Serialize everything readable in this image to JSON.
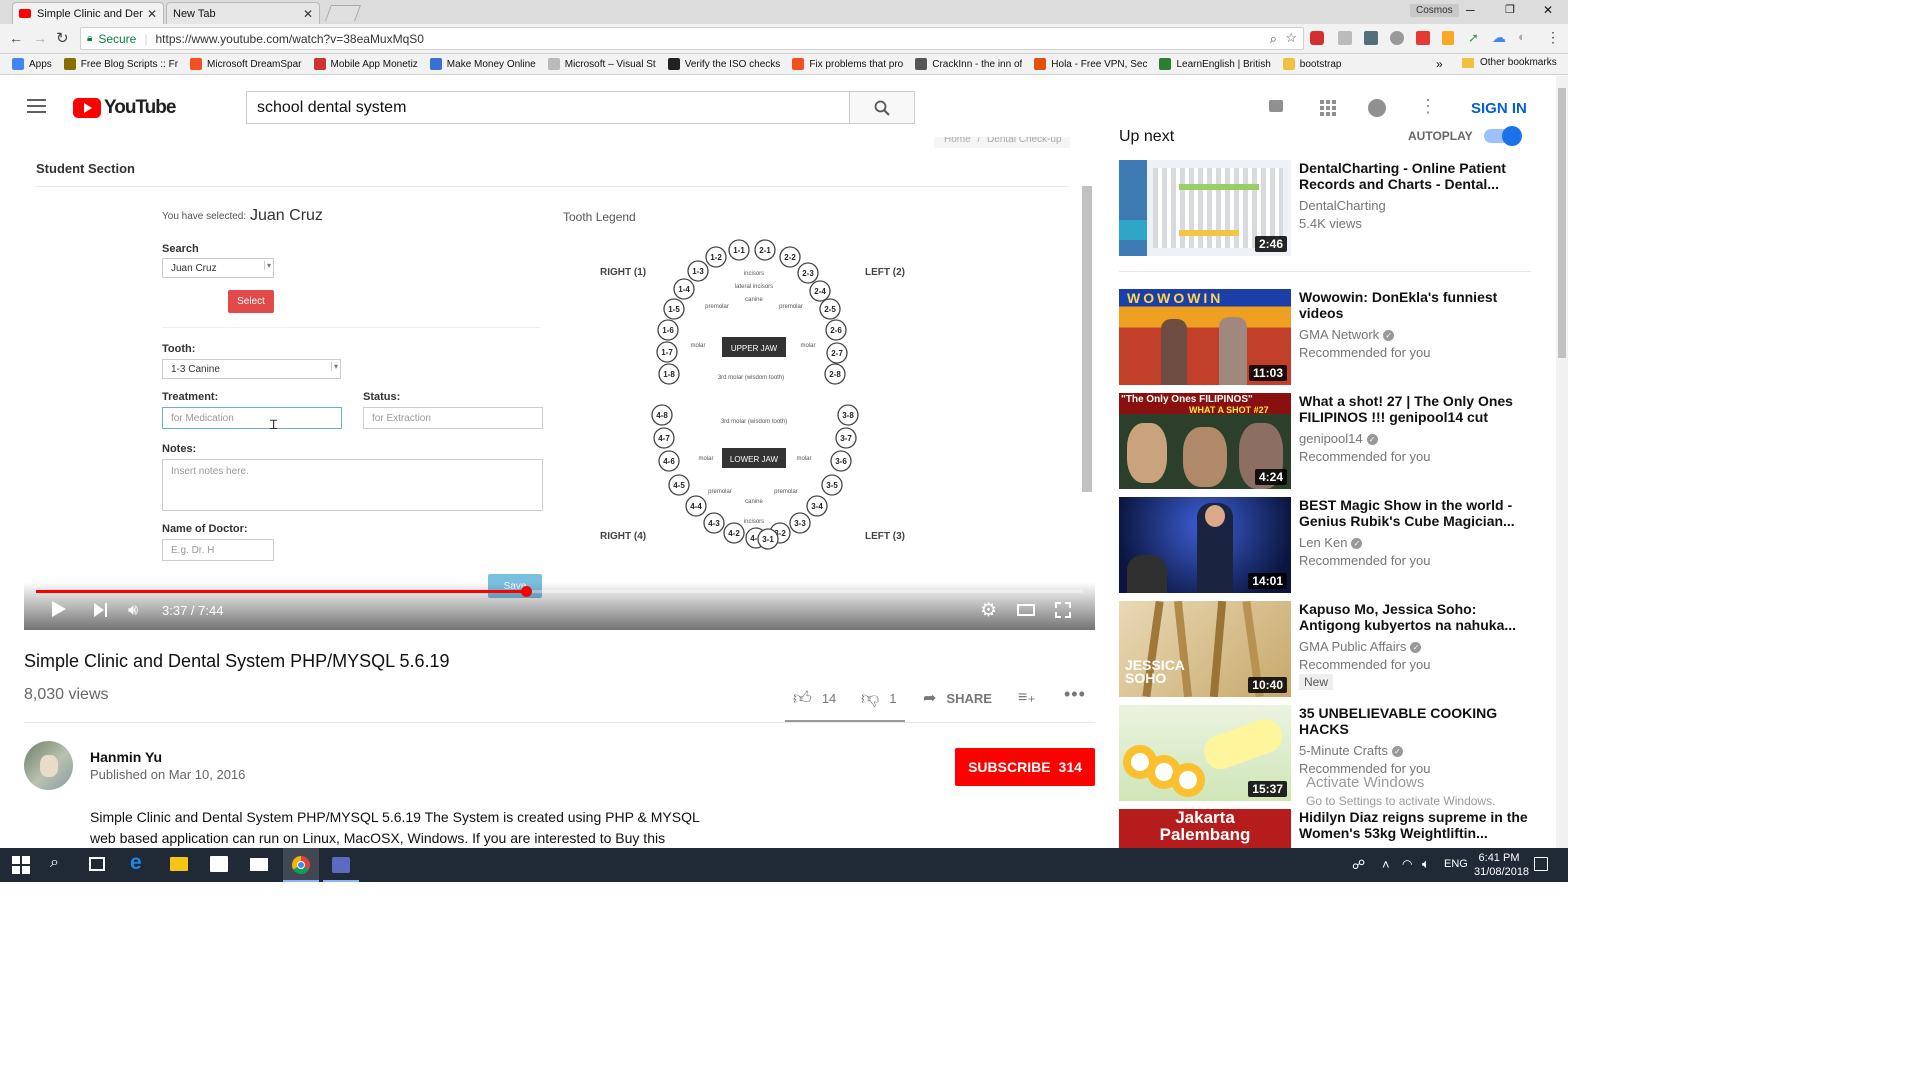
{
  "browser": {
    "tabs": [
      {
        "title": "Simple Clinic and Dental"
      },
      {
        "title": "New Tab"
      }
    ],
    "user": "Cosmos",
    "secure_label": "Secure",
    "url": "https://www.youtube.com/watch?v=38eaMuxMqS0",
    "bookmarks": [
      {
        "label": "Apps",
        "color": "#4285f4"
      },
      {
        "label": "Free Blog Scripts :: Fr",
        "color": "#8a6d00"
      },
      {
        "label": "Microsoft DreamSpar",
        "color": "#f25022"
      },
      {
        "label": "Mobile App Monetiz",
        "color": "#d32f2f"
      },
      {
        "label": "Make Money Online",
        "color": "#3b6fd6"
      },
      {
        "label": "Microsoft – Visual St",
        "color": "#bbbbbb"
      },
      {
        "label": "Verify the ISO checks",
        "color": "#222222"
      },
      {
        "label": "Fix problems that pro",
        "color": "#f25022"
      },
      {
        "label": "CrackInn - the inn of",
        "color": "#555555"
      },
      {
        "label": "Hola - Free VPN, Sec",
        "color": "#e65100"
      },
      {
        "label": "LearnEnglish | British",
        "color": "#2e7d32"
      },
      {
        "label": "bootstrap",
        "color": "#f0c040"
      }
    ],
    "bookmarks_more": "»",
    "other_bookmarks": "Other bookmarks"
  },
  "youtube": {
    "logo_text": "YouTube",
    "search_value": "school dental system",
    "sign_in": "SIGN IN"
  },
  "video_frame": {
    "section_title": "Student Section",
    "breadcrumb_home": "Home",
    "breadcrumb_sep": "/",
    "breadcrumb_page": "Dental Check-up",
    "selected_prefix": "You have selected:",
    "selected_name": "Juan Cruz",
    "search_label": "Search",
    "search_value": "Juan Cruz",
    "select_button": "Select",
    "tooth_label": "Tooth:",
    "tooth_value": "1-3 Canine",
    "treatment_label": "Treatment:",
    "treatment_value": "for Medication",
    "status_label": "Status:",
    "status_value": "for Extraction",
    "notes_label": "Notes:",
    "notes_placeholder": "Insert notes here.",
    "doctor_label": "Name of Doctor:",
    "doctor_placeholder": "E.g. Dr. H",
    "save_button": "Save",
    "legend_title": "Tooth Legend",
    "right1": "RIGHT (1)",
    "left2": "LEFT (2)",
    "right4": "RIGHT (4)",
    "left3": "LEFT (3)",
    "upper_jaw": "UPPER JAW",
    "lower_jaw": "LOWER JAW",
    "wisdom_top": "3rd molar (wisdom tooth)",
    "wisdom_bottom": "3rd molar (wisdom tooth)",
    "incisors": "incisors",
    "lateral_incisors": "lateral incisors",
    "canine": "canine",
    "premolar": "premolar",
    "molar": "molar",
    "upper_left_teeth": [
      "1-1",
      "1-2",
      "1-3",
      "1-4",
      "1-5",
      "1-6",
      "1-7",
      "1-8"
    ],
    "upper_right_teeth": [
      "2-1",
      "2-2",
      "2-3",
      "2-4",
      "2-5",
      "2-6",
      "2-7",
      "2-8"
    ],
    "lower_left_teeth": [
      "4-8",
      "4-7",
      "4-6",
      "4-5",
      "4-4",
      "4-3",
      "4-2",
      "4-1"
    ],
    "lower_right_teeth": [
      "3-8",
      "3-7",
      "3-6",
      "3-5",
      "3-4",
      "3-3",
      "3-2",
      "3-1"
    ]
  },
  "player": {
    "time": "3:37 / 7:44",
    "progress": 0.468
  },
  "video": {
    "title": "Simple Clinic and Dental System PHP/MYSQL 5.6.19",
    "views": "8,030 views",
    "likes": "14",
    "dislikes": "1",
    "share": "SHARE",
    "channel": "Hanmin Yu",
    "published": "Published on Mar 10, 2016",
    "subscribe": "SUBSCRIBE",
    "subscribers": "314",
    "description_line1": "Simple Clinic and Dental System PHP/MYSQL 5.6.19 The System is created using PHP & MYSQL",
    "description_line2": "web based application can run on Linux, MacOSX, Windows. If you are interested to Buy this"
  },
  "sidebar": {
    "up_next": "Up next",
    "autoplay": "AUTOPLAY",
    "items": [
      {
        "title": "DentalCharting - Online Patient Records and Charts - Dental...",
        "channel": "DentalCharting",
        "meta": "5.4K views",
        "duration": "2:46",
        "verified": false,
        "badge": ""
      },
      {
        "title": "Wowowin:  DonEkla's funniest videos",
        "channel": "GMA Network",
        "meta": "Recommended for you",
        "duration": "11:03",
        "verified": true,
        "badge": ""
      },
      {
        "title": "What a shot! 27 | The Only Ones FILIPINOS !!! genipool14 cut",
        "channel": "genipool14",
        "meta": "Recommended for you",
        "duration": "4:24",
        "verified": true,
        "badge": ""
      },
      {
        "title": "BEST Magic Show in the world - Genius Rubik's Cube Magician...",
        "channel": "Len Ken",
        "meta": "Recommended for you",
        "duration": "14:01",
        "verified": true,
        "badge": ""
      },
      {
        "title": "Kapuso Mo, Jessica Soho: Antigong kubyertos na nahuka...",
        "channel": "GMA Public Affairs",
        "meta": "Recommended for you",
        "duration": "10:40",
        "verified": true,
        "badge": "New"
      },
      {
        "title": "35 UNBELIEVABLE COOKING HACKS",
        "channel": "5-Minute Crafts",
        "meta": "Recommended for you",
        "duration": "15:37",
        "verified": true,
        "badge": ""
      },
      {
        "title": "Hidilyn Diaz reigns supreme in the Women's 53kg Weightliftin...",
        "channel": "",
        "meta": "",
        "duration": "",
        "verified": false,
        "badge": ""
      }
    ],
    "thumb_texts": {
      "wowowin": "WOWOWIN",
      "filipinos": "\"The Only Ones FILIPINOS\"",
      "shot27": "WHAT A SHOT #27",
      "jessica": "JESSICA SOHO",
      "jakarta": "Jakarta Palembang"
    }
  },
  "watermark": {
    "line1": "Activate Windows",
    "line2": "Go to Settings to activate Windows."
  },
  "taskbar": {
    "language": "ENG",
    "time": "6:41 PM",
    "date": "31/08/2018"
  }
}
